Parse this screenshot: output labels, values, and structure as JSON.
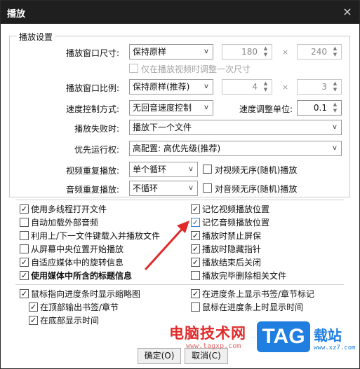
{
  "window": {
    "title": "播放",
    "close_glyph": "×"
  },
  "group": {
    "label": "播放设置"
  },
  "rows": {
    "size_label": "播放窗口尺寸:",
    "size_value": "保持原样",
    "size_w": "180",
    "size_h": "240",
    "size_once": "仅在播放视频时调整一次尺寸",
    "ratio_label": "播放窗口比例:",
    "ratio_value": "保持原样(推荐)",
    "ratio_a": "4",
    "ratio_b": "3",
    "speed_label": "速度控制方式:",
    "speed_value": "无回音速度控制",
    "speed_unit_label": "速度调整单位:",
    "speed_unit_value": "0.1",
    "fail_label": "播放失败时:",
    "fail_value": "播放下一个文件",
    "priority_label": "优先运行权:",
    "priority_value": "高配置: 高优先级(推荐)",
    "video_repeat_label": "视频重复播放:",
    "video_repeat_value": "单个循环",
    "video_random": "对视频无序(随机)播放",
    "audio_repeat_label": "音频重复播放:",
    "audio_repeat_value": "不循环",
    "audio_random": "对音频无序(随机)播放",
    "times": "×"
  },
  "options_left": [
    {
      "label": "使用多线程打开文件",
      "checked": "✓"
    },
    {
      "label": "自动加载外部音频",
      "checked": ""
    },
    {
      "label": "利用上/下一文件键载入并播放文件",
      "checked": ""
    },
    {
      "label": "从屏幕中央位置开始播放",
      "checked": ""
    },
    {
      "label": "自适应媒体中的旋转信息",
      "checked": "✓"
    },
    {
      "label": "使用媒体中所含的标题信息",
      "checked": "✓"
    }
  ],
  "options_right": [
    {
      "label": "记忆视频播放位置",
      "checked": "✓"
    },
    {
      "label": "记忆音频播放位置",
      "checked": "✓"
    },
    {
      "label": "播放时禁止屏保",
      "checked": "✓"
    },
    {
      "label": "播放时隐藏指针",
      "checked": "✓"
    },
    {
      "label": "播放结束后关闭",
      "checked": "✓"
    },
    {
      "label": "播放完毕删除相关文件",
      "checked": ""
    }
  ],
  "thumb": {
    "main": "鼠标指向进度条时显示缩略图",
    "top_bookmark": "在顶部输出书签/章节",
    "bottom_time": "在底部显示时间",
    "show_marks": "在进度条上显示书签/章节标记",
    "show_time": "鼠标在进度条上时显示时间"
  },
  "buttons": {
    "ok": "确定(O)",
    "cancel": "取消(C)"
  },
  "watermark": {
    "site": "电脑技术网",
    "url": "www.tagxp.com",
    "tag": "TAG",
    "tag_suffix": "载站",
    "small": "www.xz7.com"
  }
}
